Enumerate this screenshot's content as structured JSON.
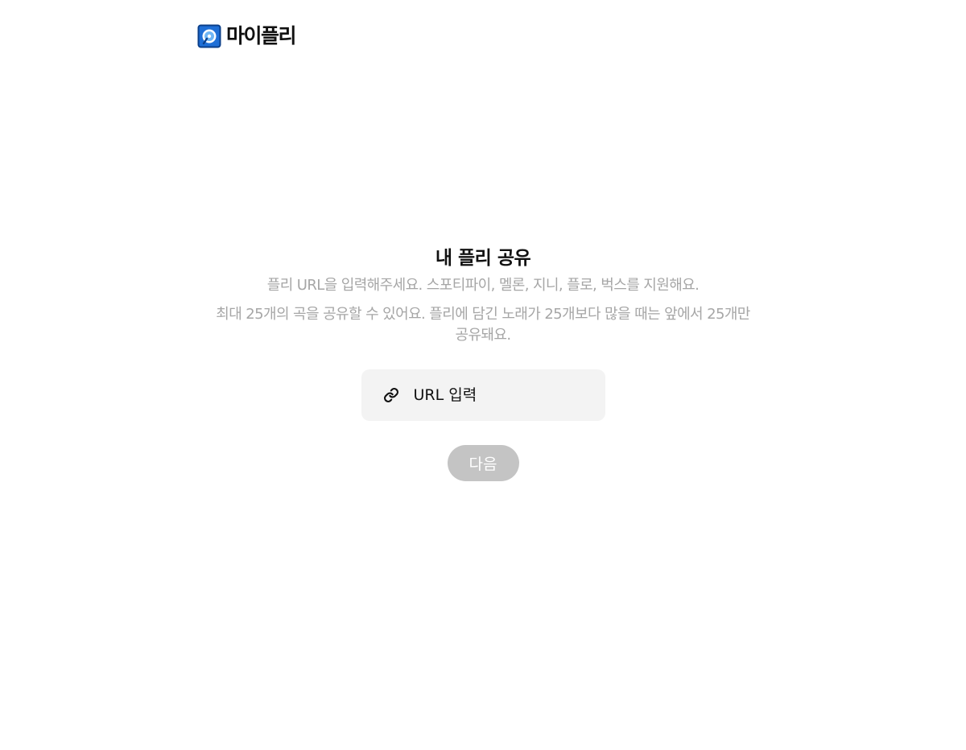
{
  "header": {
    "logo_icon": "playlist-disc-icon",
    "logo_text": "마이플리",
    "brand_color": "#1f6fd6"
  },
  "main": {
    "title": "내 플리 공유",
    "description_1": "플리 URL을 입력해주세요. 스포티파이, 멜론, 지니, 플로, 벅스를 지원해요.",
    "description_2": "최대 25개의 곡을 공유할 수 있어요. 플리에 담긴 노래가 25개보다 많을 때는 앞에서 25개만 공유돼요.",
    "url_field": {
      "icon": "link-icon",
      "placeholder": "URL 입력",
      "value": ""
    },
    "next_button": {
      "label": "다음",
      "enabled": false,
      "color": "#c4c4c4"
    }
  }
}
